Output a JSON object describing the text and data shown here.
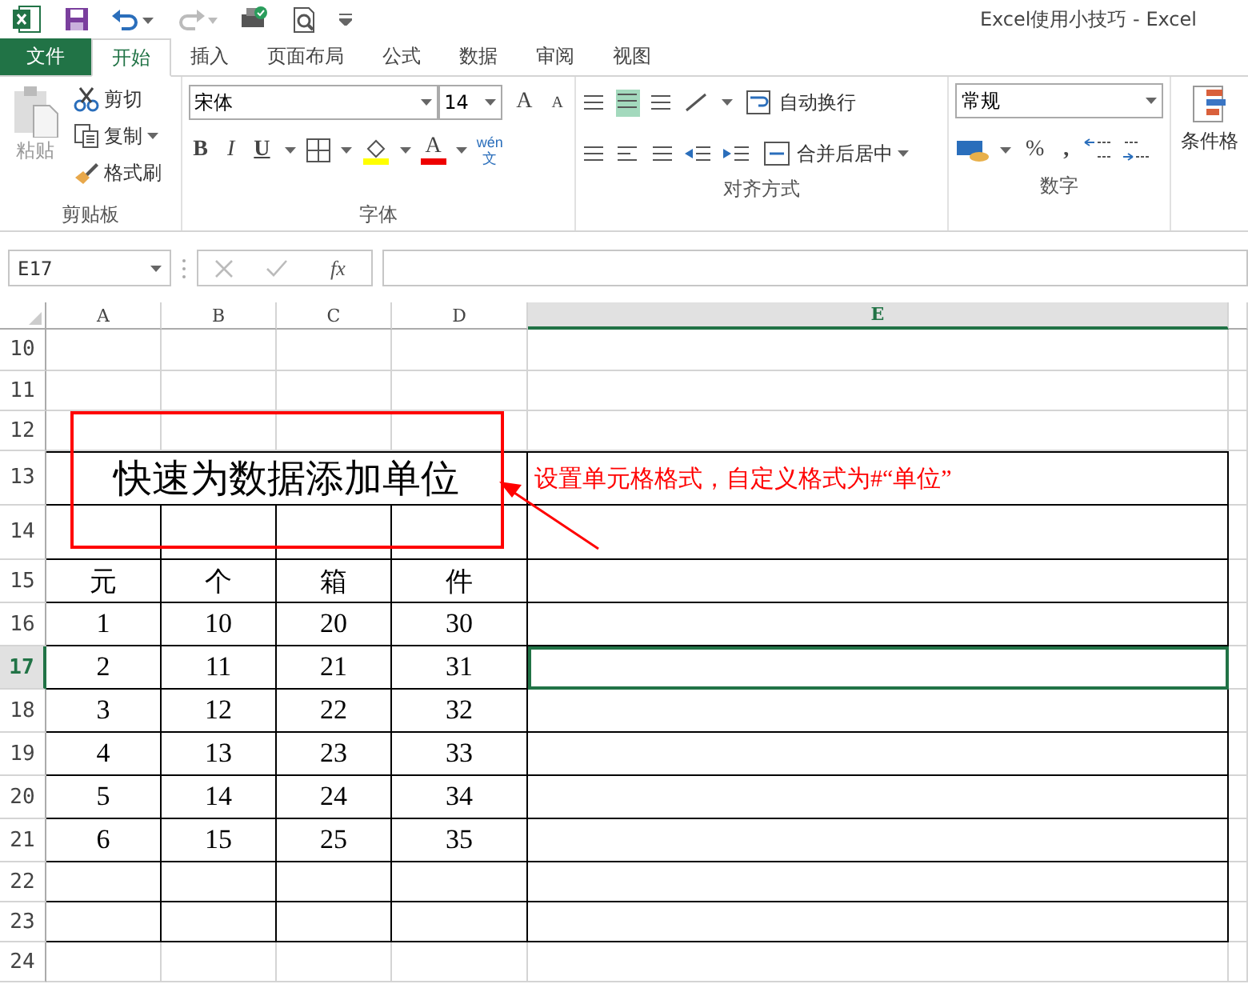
{
  "window": {
    "title": "Excel使用小技巧 - Excel"
  },
  "tabs": [
    {
      "label": "文件",
      "kind": "file",
      "selected": false
    },
    {
      "label": "开始",
      "kind": "tab",
      "selected": true
    },
    {
      "label": "插入",
      "kind": "tab",
      "selected": false
    },
    {
      "label": "页面布局",
      "kind": "tab",
      "selected": false
    },
    {
      "label": "公式",
      "kind": "tab",
      "selected": false
    },
    {
      "label": "数据",
      "kind": "tab",
      "selected": false
    },
    {
      "label": "审阅",
      "kind": "tab",
      "selected": false
    },
    {
      "label": "视图",
      "kind": "tab",
      "selected": false
    }
  ],
  "ribbon": {
    "clipboard": {
      "paste": "粘贴",
      "cut": "剪切",
      "copy": "复制",
      "format_painter": "格式刷",
      "group": "剪贴板"
    },
    "font": {
      "name": "宋体",
      "size": "14",
      "grow": "A",
      "shrink": "A",
      "bold": "B",
      "italic": "I",
      "underline": "U",
      "font_color": "A",
      "phonetic_top": "wén",
      "phonetic_bottom": "文",
      "group": "字体"
    },
    "alignment": {
      "wrap": "自动换行",
      "merge": "合并后居中",
      "group": "对齐方式"
    },
    "number": {
      "format": "常规",
      "percent": "%",
      "comma": ",",
      "group": "数字"
    },
    "styles": {
      "conditional": "条件格"
    }
  },
  "formula_bar": {
    "name_box": "E17",
    "function_label": "fx"
  },
  "sheet": {
    "columns": [
      {
        "label": "A",
        "selected": false
      },
      {
        "label": "B",
        "selected": false
      },
      {
        "label": "C",
        "selected": false
      },
      {
        "label": "D",
        "selected": false
      },
      {
        "label": "E",
        "selected": true
      }
    ],
    "rows": [
      {
        "label": "10",
        "kind": "normal",
        "bordered": false,
        "selected": false
      },
      {
        "label": "11",
        "kind": "normal",
        "bordered": false,
        "selected": false
      },
      {
        "label": "12",
        "kind": "normal",
        "bordered": false,
        "selected": false
      },
      {
        "label": "13",
        "kind": "tall",
        "bordered": true,
        "selected": false,
        "title": "快速为数据添加单位",
        "note": "设置单元格格式，自定义格式为#“单位”"
      },
      {
        "label": "14",
        "kind": "tall",
        "bordered": true,
        "selected": false
      },
      {
        "label": "15",
        "kind": "medium",
        "bordered": true,
        "selected": false,
        "values": [
          "元",
          "个",
          "箱",
          "件"
        ]
      },
      {
        "label": "16",
        "kind": "medium",
        "bordered": true,
        "selected": false,
        "values": [
          "1",
          "10",
          "20",
          "30"
        ]
      },
      {
        "label": "17",
        "kind": "medium",
        "bordered": true,
        "selected": true,
        "values": [
          "2",
          "11",
          "21",
          "31"
        ]
      },
      {
        "label": "18",
        "kind": "medium",
        "bordered": true,
        "selected": false,
        "values": [
          "3",
          "12",
          "22",
          "32"
        ]
      },
      {
        "label": "19",
        "kind": "medium",
        "bordered": true,
        "selected": false,
        "values": [
          "4",
          "13",
          "23",
          "33"
        ]
      },
      {
        "label": "20",
        "kind": "medium",
        "bordered": true,
        "selected": false,
        "values": [
          "5",
          "14",
          "24",
          "34"
        ]
      },
      {
        "label": "21",
        "kind": "medium",
        "bordered": true,
        "selected": false,
        "values": [
          "6",
          "15",
          "25",
          "35"
        ]
      },
      {
        "label": "22",
        "kind": "normal",
        "bordered": true,
        "selected": false
      },
      {
        "label": "23",
        "kind": "normal",
        "bordered": true,
        "selected": false
      },
      {
        "label": "24",
        "kind": "short",
        "bordered": false,
        "selected": false
      }
    ]
  }
}
